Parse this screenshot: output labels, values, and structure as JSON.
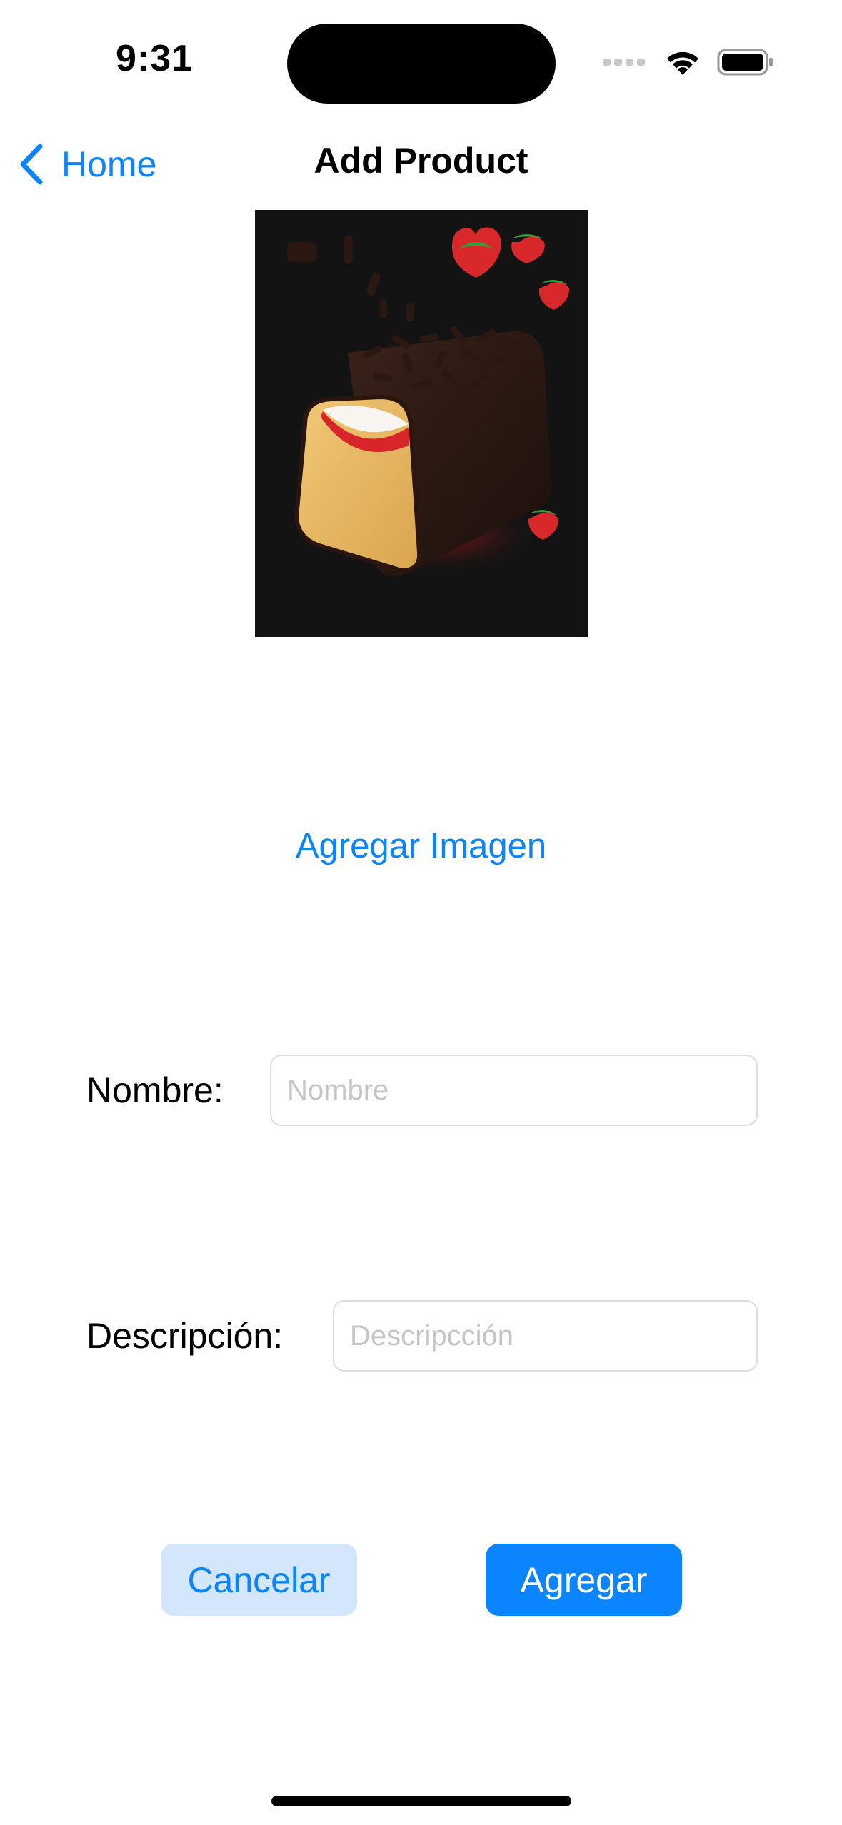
{
  "status_bar": {
    "time": "9:31",
    "signal_icon": "cellular-dots-icon",
    "wifi_icon": "wifi-icon",
    "battery_icon": "battery-icon"
  },
  "nav": {
    "back_label": "Home",
    "back_icon": "chevron-left-icon",
    "title": "Add Product"
  },
  "product_image": {
    "description": "chocolate-covered cake bar with strawberries"
  },
  "add_image_label": "Agregar Imagen",
  "form": {
    "name_label": "Nombre:",
    "name_placeholder": "Nombre",
    "name_value": "",
    "description_label": "Descripción:",
    "description_placeholder": "Descripcción",
    "description_value": ""
  },
  "buttons": {
    "cancel_label": "Cancelar",
    "add_label": "Agregar"
  },
  "colors": {
    "accent": "#0a84ff",
    "cancel_bg": "#d3e6fc",
    "placeholder": "#c5c5c9"
  }
}
